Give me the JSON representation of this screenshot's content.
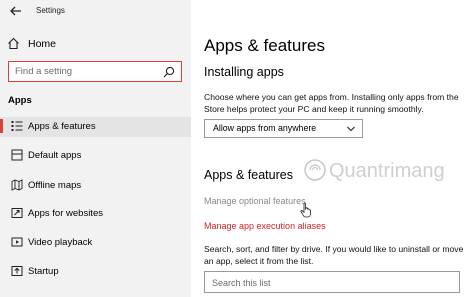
{
  "window": {
    "title": "Settings"
  },
  "sidebar": {
    "home_label": "Home",
    "search": {
      "placeholder": "Find a setting"
    },
    "section_label": "Apps",
    "items": [
      {
        "label": "Apps & features",
        "icon": "list-icon",
        "selected": true
      },
      {
        "label": "Default apps",
        "icon": "default-apps-icon",
        "selected": false
      },
      {
        "label": "Offline maps",
        "icon": "map-icon",
        "selected": false
      },
      {
        "label": "Apps for websites",
        "icon": "web-link-icon",
        "selected": false
      },
      {
        "label": "Video playback",
        "icon": "video-icon",
        "selected": false
      },
      {
        "label": "Startup",
        "icon": "startup-icon",
        "selected": false
      }
    ]
  },
  "main": {
    "title": "Apps & features",
    "installing": {
      "heading": "Installing apps",
      "description": "Choose where you can get apps from. Installing only apps from the Store helps protect your PC and keep it running smoothly.",
      "dropdown_value": "Allow apps from anywhere"
    },
    "features": {
      "heading": "Apps & features",
      "optional_link": "Manage optional features",
      "aliases_link": "Manage app execution aliases",
      "description": "Search, sort, and filter by drive. If you would like to uninstall or move an app, select it from the list.",
      "search_placeholder": "Search this list"
    }
  },
  "watermark": {
    "text": "Quantrimang"
  },
  "colors": {
    "accent": "#d9413c",
    "link": "#d0232a",
    "sidebar_bg": "#f2f2f2"
  }
}
